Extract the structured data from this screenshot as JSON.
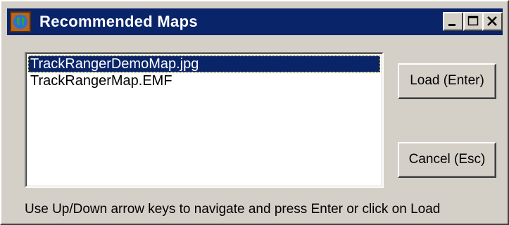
{
  "window": {
    "title": "Recommended Maps",
    "icon": "globe-icon",
    "controls": [
      "minimize-icon",
      "maximize-icon",
      "close-icon"
    ]
  },
  "list": {
    "items": [
      {
        "label": "TrackRangerDemoMap.jpg",
        "selected": true
      },
      {
        "label": "TrackRangerMap.EMF",
        "selected": false
      }
    ]
  },
  "buttons": {
    "load_label": "Load (Enter)",
    "cancel_label": "Cancel (Esc)"
  },
  "hint": "Use Up/Down arrow keys to navigate and press Enter or click on Load",
  "colors": {
    "titlebar": "#0a246a",
    "face": "#d4d0c8",
    "selection": "#0a246a"
  }
}
